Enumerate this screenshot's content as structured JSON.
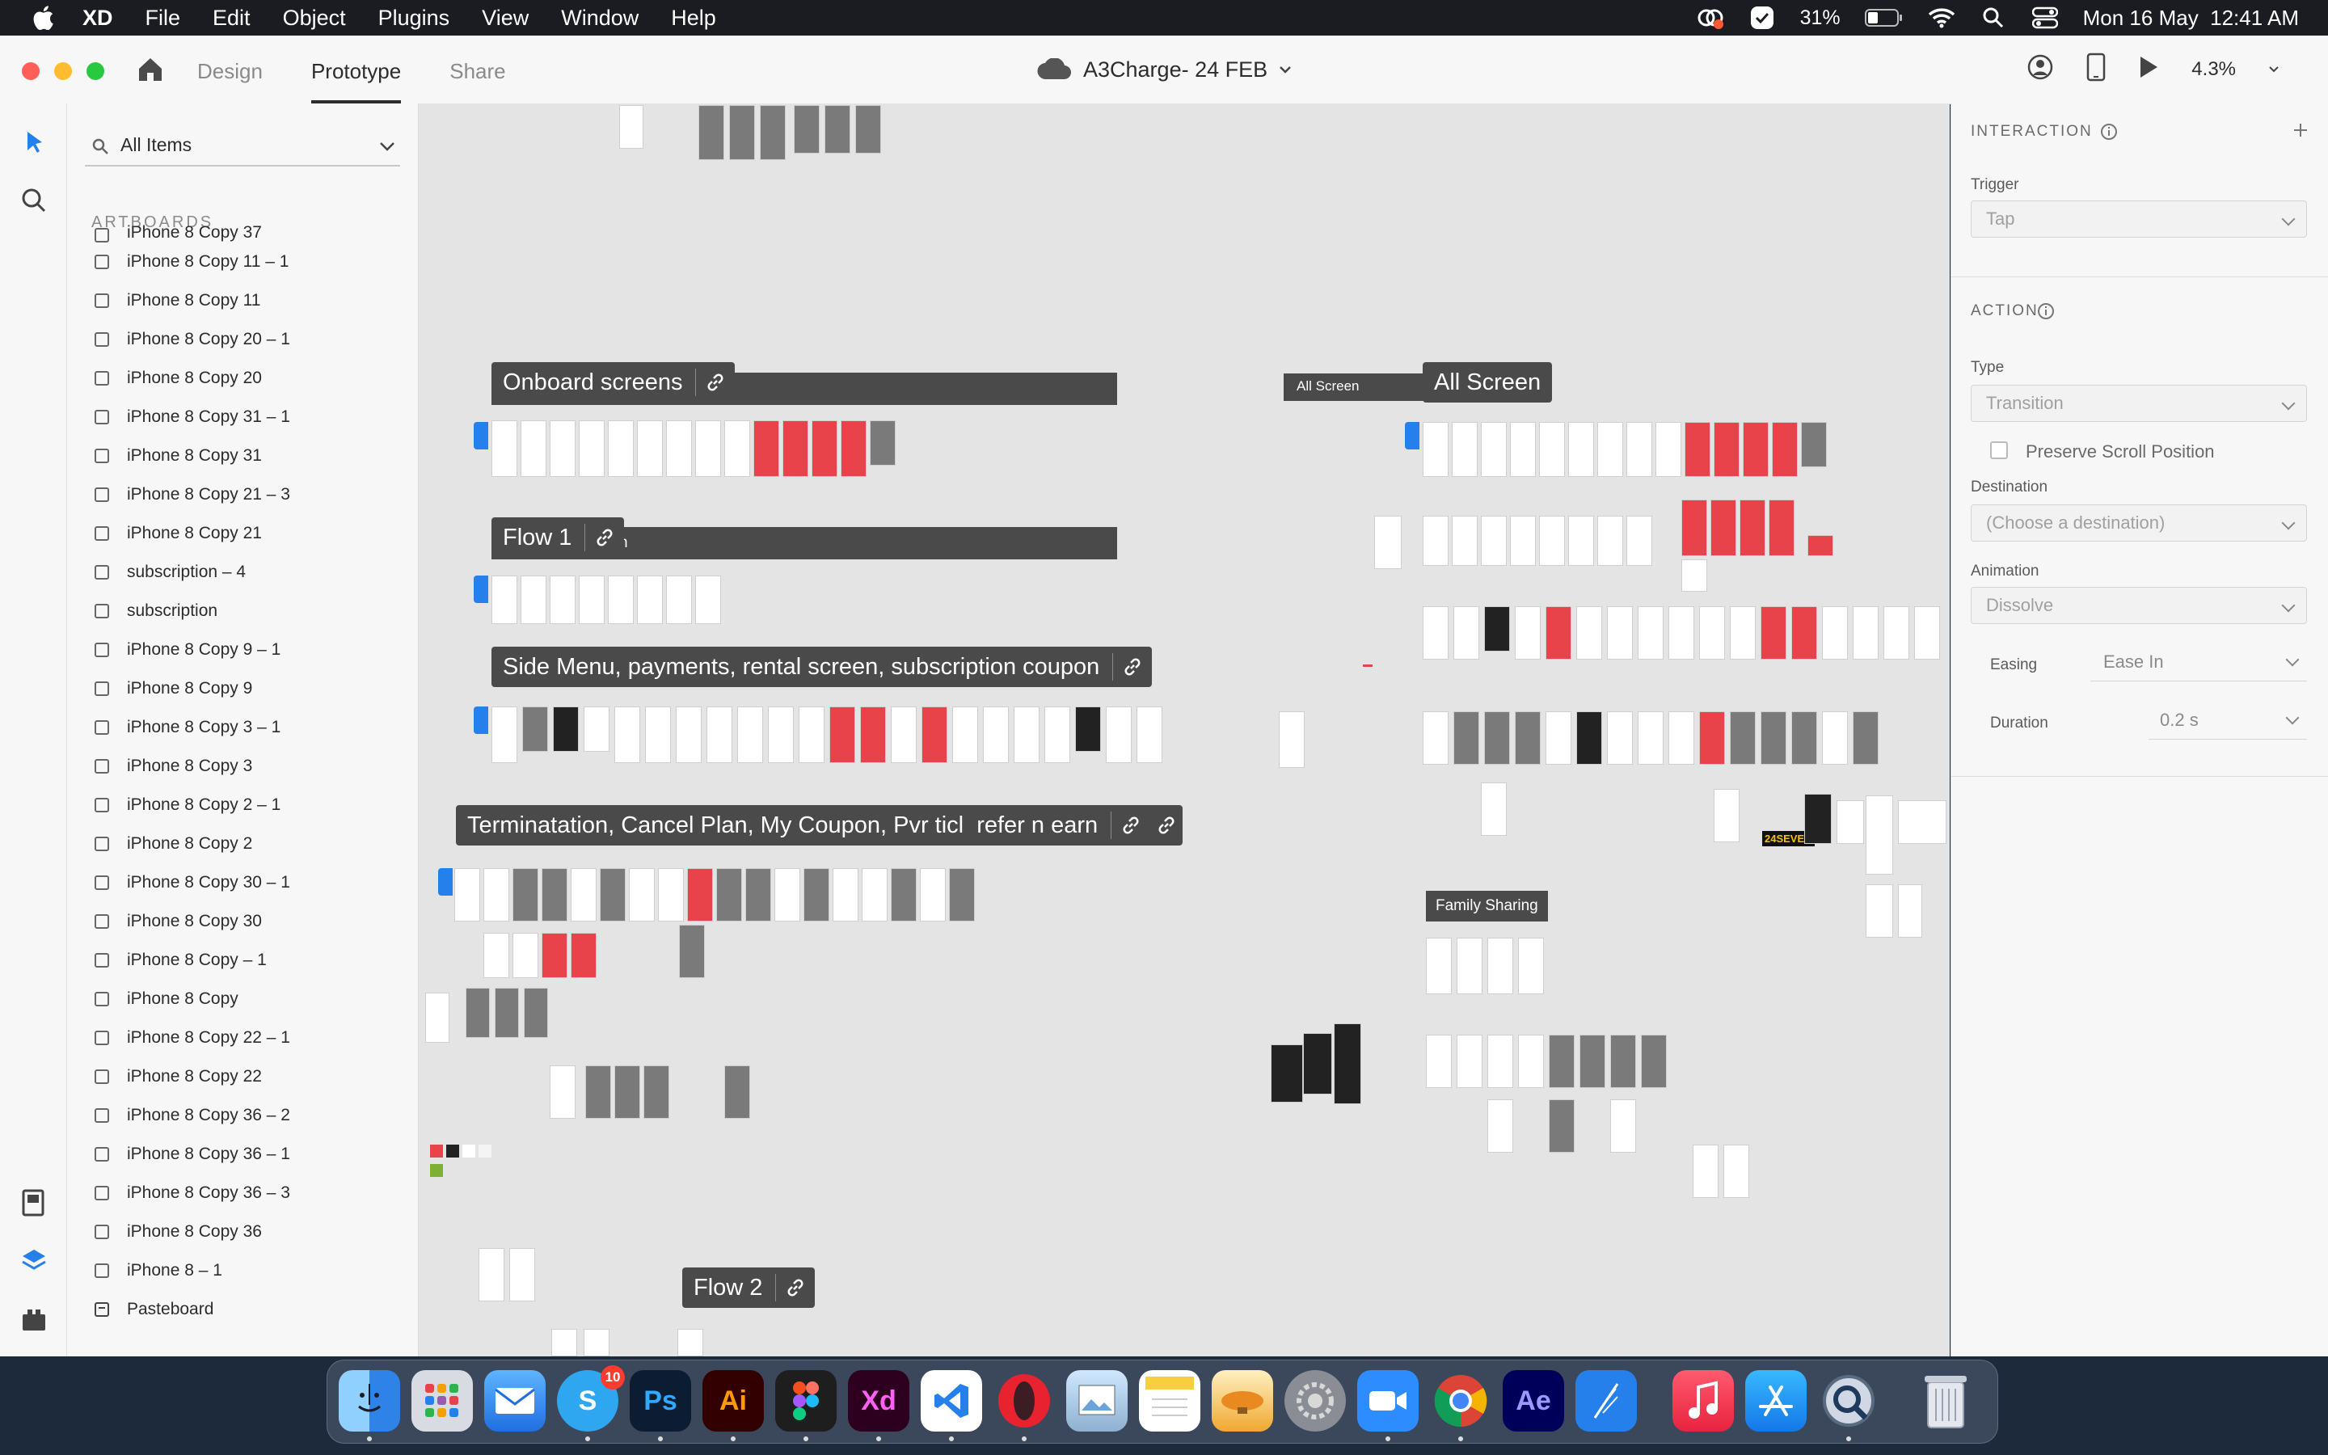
{
  "menubar": {
    "app_name": "XD",
    "menus": [
      "File",
      "Edit",
      "Object",
      "Plugins",
      "View",
      "Window",
      "Help"
    ],
    "battery": "31%",
    "clock": "Mon 16 May  12:41 AM"
  },
  "toolbar": {
    "tabs": [
      "Design",
      "Prototype",
      "Share"
    ],
    "active_tab": "Prototype",
    "document_title": "A3Charge- 24 FEB",
    "zoom": "4.3%"
  },
  "layers": {
    "filter": "All Items",
    "section": "ARTBOARDS",
    "items": [
      "iPhone 8 Copy 37",
      "iPhone 8 Copy 11 – 1",
      "iPhone 8 Copy 11",
      "iPhone 8 Copy 20 – 1",
      "iPhone 8 Copy 20",
      "iPhone 8 Copy 31 – 1",
      "iPhone 8 Copy 31",
      "iPhone 8 Copy 21 – 3",
      "iPhone 8 Copy 21",
      "subscription – 4",
      "subscription",
      "iPhone 8 Copy 9 – 1",
      "iPhone 8 Copy 9",
      "iPhone 8 Copy 3 – 1",
      "iPhone 8 Copy 3",
      "iPhone 8 Copy 2 – 1",
      "iPhone 8 Copy 2",
      "iPhone 8 Copy 30 – 1",
      "iPhone 8 Copy 30",
      "iPhone 8 Copy – 1",
      "iPhone 8 Copy",
      "iPhone 8 Copy 22 – 1",
      "iPhone 8 Copy 22",
      "iPhone 8 Copy 36 – 2",
      "iPhone 8 Copy 36 – 1",
      "iPhone 8 Copy 36 – 3",
      "iPhone 8 Copy 36",
      "iPhone 8 – 1",
      "Pasteboard"
    ]
  },
  "canvas": {
    "flows": {
      "onboard": "Onboard screens",
      "flow1": "Flow 1",
      "flow1_tail": "n",
      "side_menu": "Side Menu, payments, rental screen, subscription coupon",
      "termination": "Terminatation, Cancel Plan, My Coupon, Pvr ticl  refer n earn",
      "flow2": "Flow 2",
      "all_screen": "All Screen",
      "all_screen_small": "All Screen",
      "family_sharing": "Family Sharing",
      "brand_tag": "24SEVEN"
    }
  },
  "inspector": {
    "interaction_title": "INTERACTION",
    "trigger_label": "Trigger",
    "trigger_value": "Tap",
    "action_title": "ACTION",
    "type_label": "Type",
    "type_value": "Transition",
    "preserve_scroll": "Preserve Scroll Position",
    "preserve_scroll_checked": false,
    "destination_label": "Destination",
    "destination_value": "(Choose a destination)",
    "animation_label": "Animation",
    "animation_value": "Dissolve",
    "easing_label": "Easing",
    "easing_value": "Ease In",
    "duration_label": "Duration",
    "duration_value": "0.2 s"
  },
  "dock": {
    "apps": [
      "finder",
      "launchpad",
      "mail",
      "skype",
      "photoshop",
      "illustrator",
      "figma",
      "xd",
      "vscode",
      "opera",
      "preview",
      "notes",
      "transmit",
      "system-preferences",
      "zoom",
      "chrome",
      "after-effects",
      "feather",
      "music",
      "app-store",
      "quicktime",
      "trash"
    ],
    "skype_badge": "10",
    "ps_label": "Ps",
    "ai_label": "Ai",
    "xd_label": "Xd",
    "ae_label": "Ae"
  },
  "colors": {
    "accent_blue": "#2680eb",
    "artboard_red": "#e8424a",
    "flow_label_bg": "#4a4a4a",
    "canvas_bg": "#e4e4e4"
  }
}
